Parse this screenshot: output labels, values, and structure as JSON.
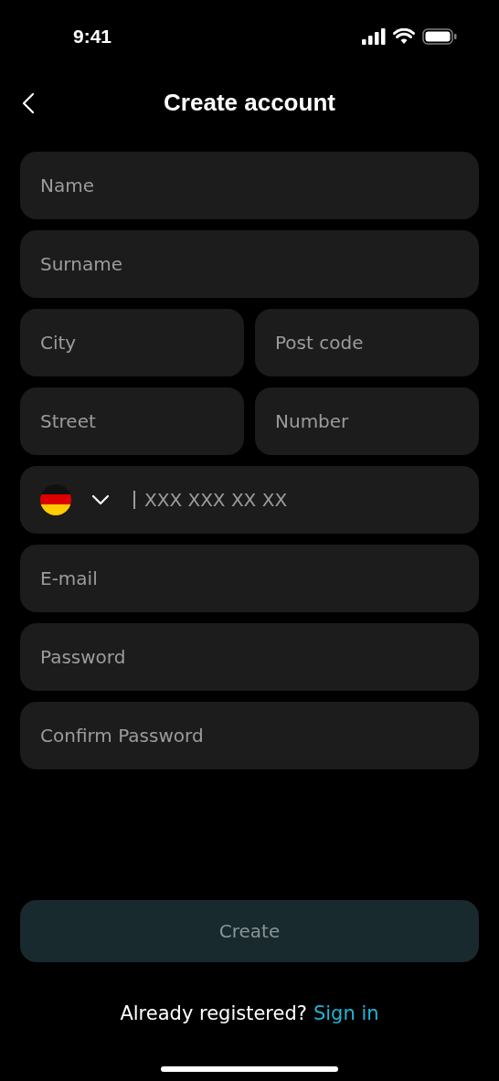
{
  "status_bar": {
    "time": "9:41"
  },
  "header": {
    "title": "Create account"
  },
  "fields": [
    {
      "kind": "text",
      "placeholder": "Name"
    },
    {
      "kind": "text",
      "placeholder": "Surname"
    },
    {
      "kind": "pair",
      "items": [
        {
          "placeholder": "City"
        },
        {
          "placeholder": "Post code"
        }
      ]
    },
    {
      "kind": "pair",
      "items": [
        {
          "placeholder": "Street"
        },
        {
          "placeholder": "Number"
        }
      ]
    },
    {
      "kind": "phone",
      "placeholder": "XXX XXX XX XX",
      "focused": true
    },
    {
      "kind": "text",
      "placeholder": "E-mail"
    },
    {
      "kind": "password",
      "placeholder": "Password"
    },
    {
      "kind": "password",
      "placeholder": "Confirm Password"
    }
  ],
  "create_button": {
    "label": "Create",
    "disabled": true
  },
  "footer": {
    "text": "Already registered?",
    "link": "Sign in"
  }
}
